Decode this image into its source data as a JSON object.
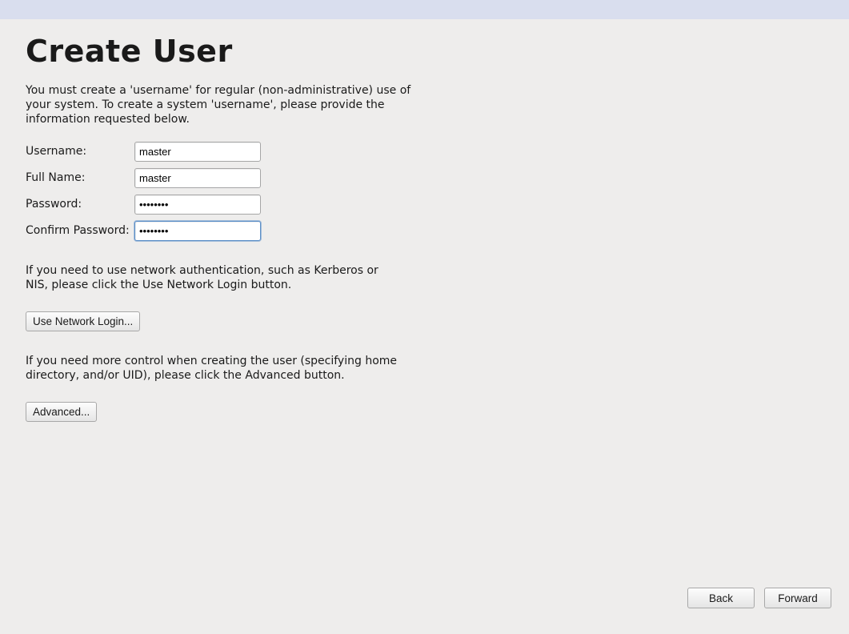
{
  "page": {
    "title": "Create User",
    "intro": "You must create a 'username' for regular (non-administrative) use of your system.  To create a system 'username', please provide the information requested below."
  },
  "form": {
    "username_label": "Username:",
    "username_value": "master",
    "fullname_label": "Full Name:",
    "fullname_value": "master",
    "password_label": "Password:",
    "password_value": "••••••••",
    "confirm_label": "Confirm Password:",
    "confirm_value": "••••••••"
  },
  "network": {
    "note": "If you need to use network authentication, such as Kerberos or NIS, please click the Use Network Login button.",
    "button_label": "Use Network Login..."
  },
  "advanced": {
    "note": "If you need more control when creating the user (specifying home directory, and/or UID), please click the Advanced button.",
    "button_label": "Advanced..."
  },
  "footer": {
    "back_label": "Back",
    "forward_label": "Forward"
  }
}
